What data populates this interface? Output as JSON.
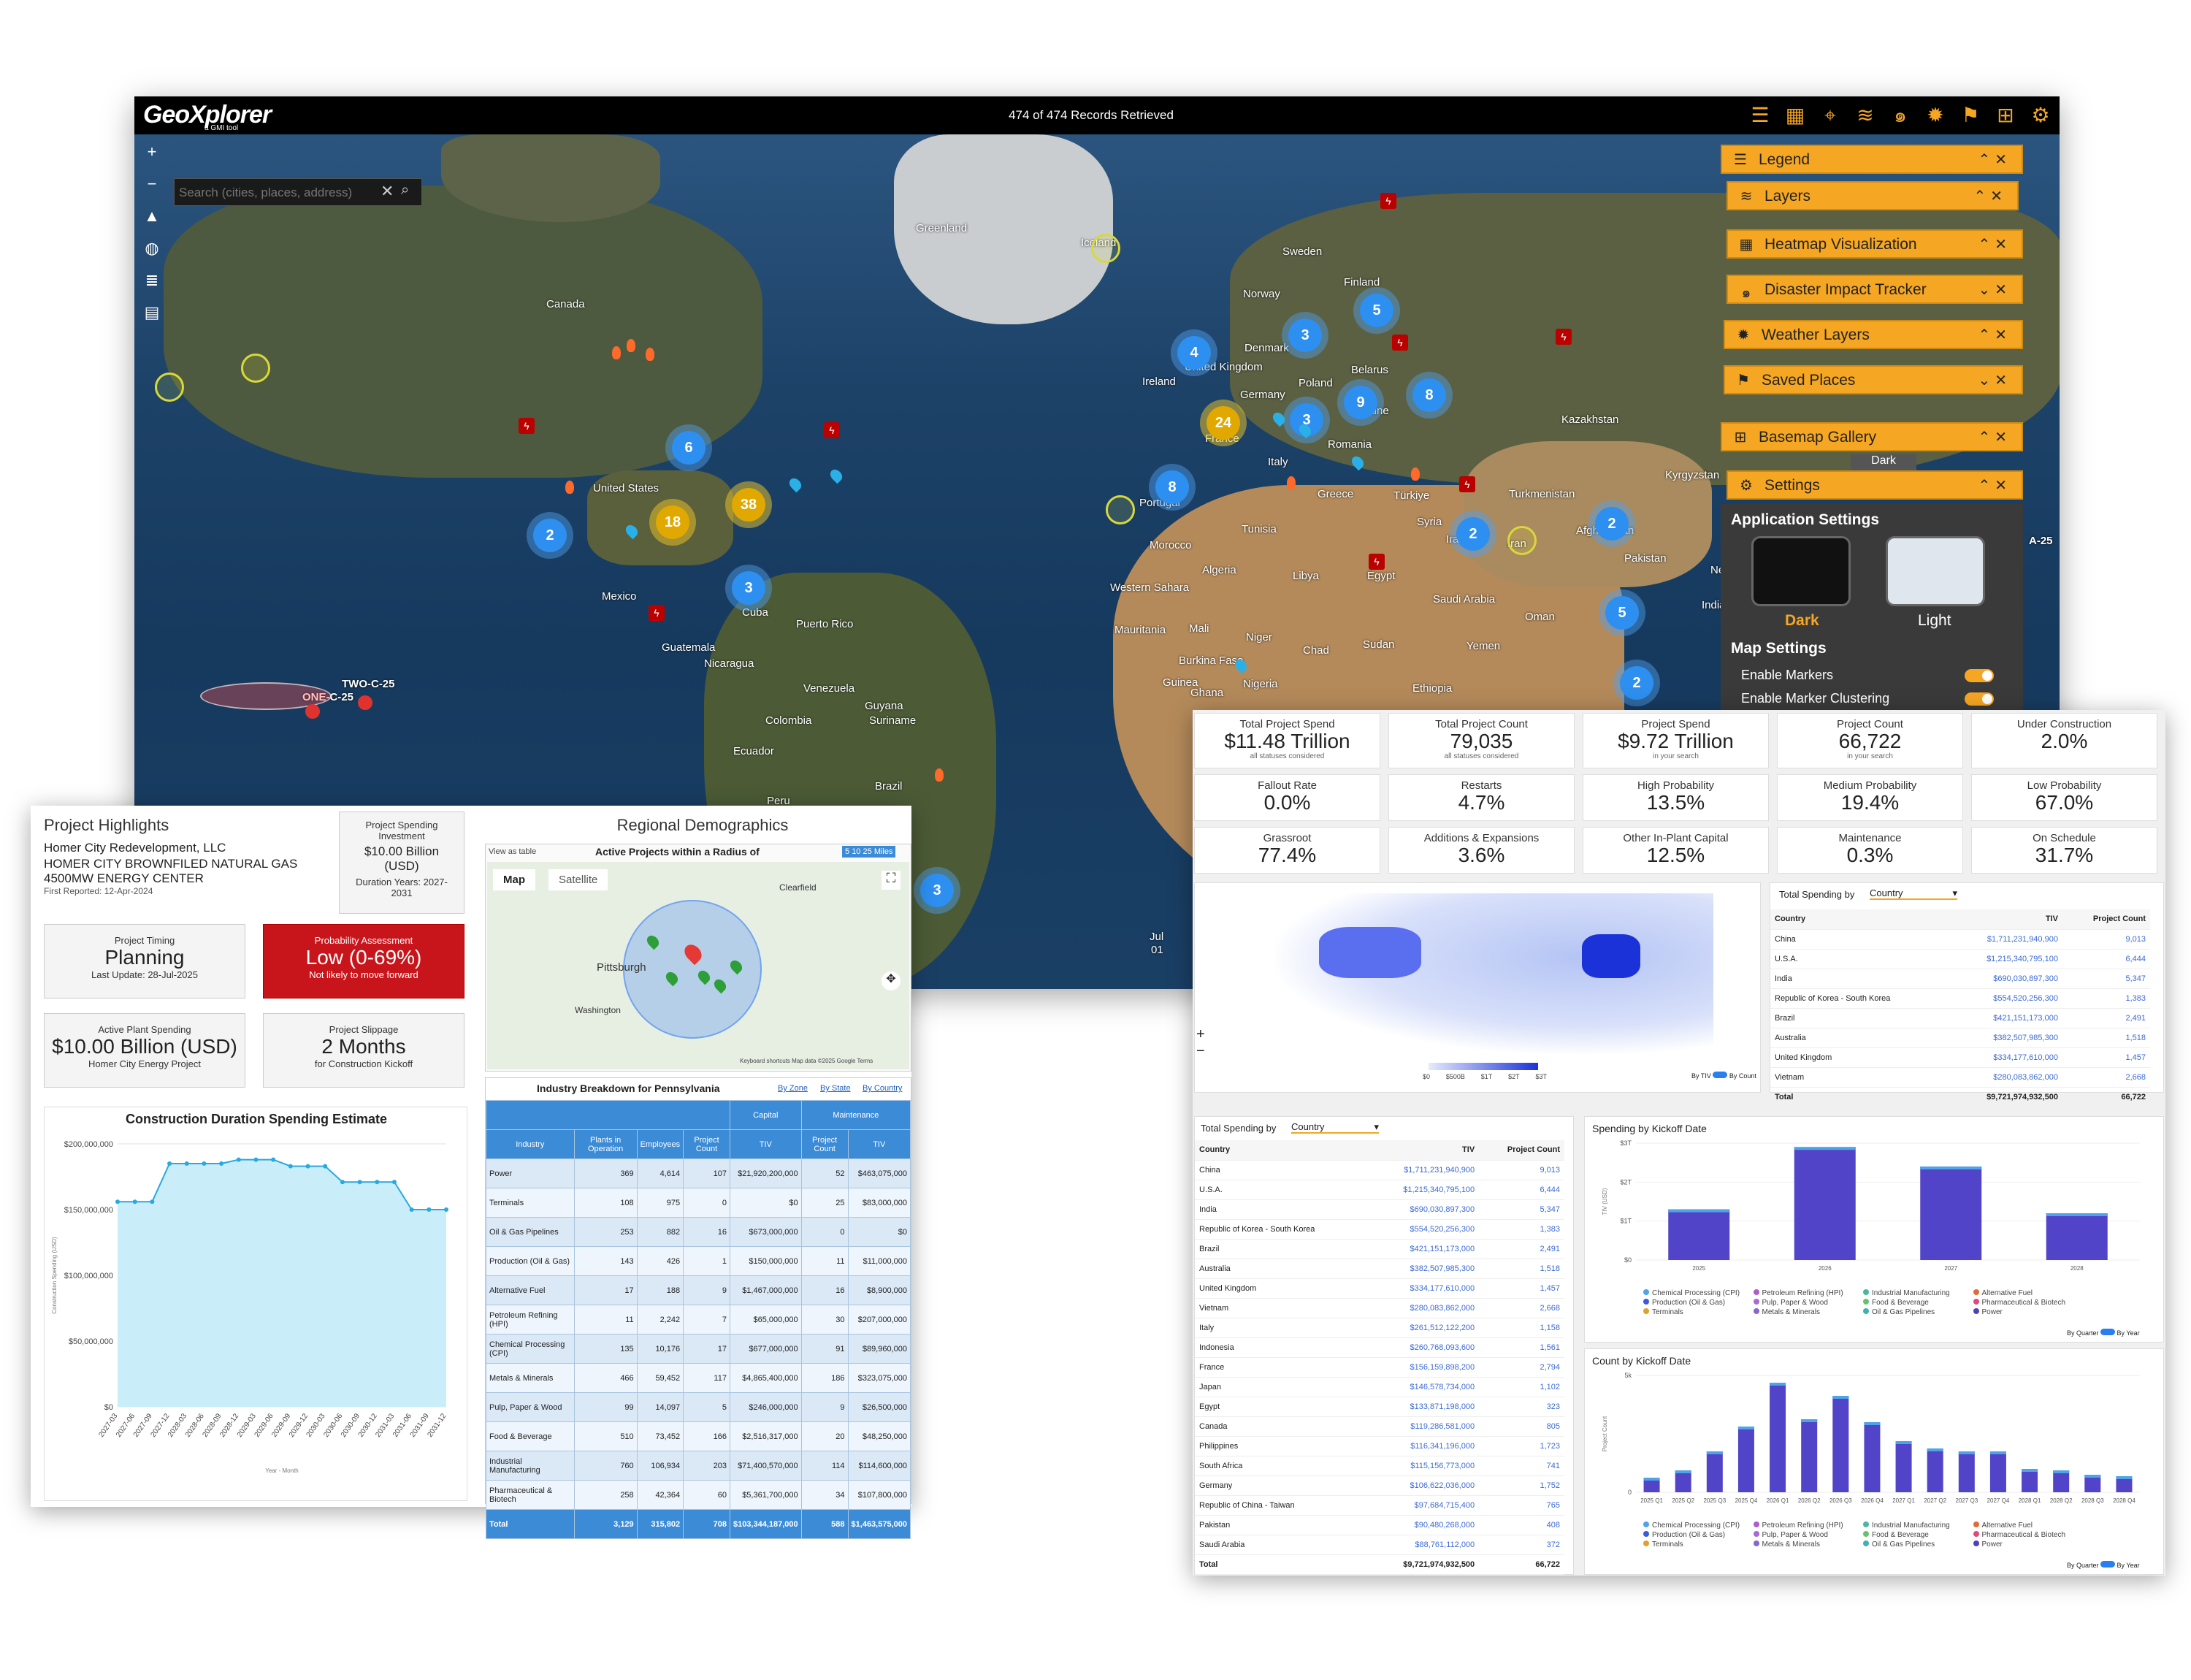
{
  "app": {
    "logo": "GeoXplorer",
    "logo_sub": "a GMI tool",
    "records": "474 of 474 Records Retrieved",
    "search_placeholder": "Search (cities, places, address)"
  },
  "panels": [
    {
      "label": "Legend",
      "icon": "list-icon"
    },
    {
      "label": "Layers",
      "icon": "layers-icon"
    },
    {
      "label": "Heatmap Visualization",
      "icon": "grid-icon"
    },
    {
      "label": "Disaster Impact Tracker",
      "icon": "hurricane-icon"
    },
    {
      "label": "Weather Layers",
      "icon": "gear-cloud-icon"
    },
    {
      "label": "Saved Places",
      "icon": "bookmark-icon"
    },
    {
      "label": "Basemap Gallery",
      "icon": "gallery-icon"
    },
    {
      "label": "Settings",
      "icon": "gear-icon"
    }
  ],
  "settings": {
    "app_heading": "Application Settings",
    "dark": "Dark",
    "light": "Light",
    "map_heading": "Map Settings",
    "enable_markers": "Enable Markers",
    "enable_clustering": "Enable Marker Clustering",
    "basemap_peek": "Dark"
  },
  "map_labels": {
    "greenland": "Greenland",
    "iceland": "Iceland",
    "sweden": "Sweden",
    "finland": "Finland",
    "norway": "Norway",
    "canada": "Canada",
    "denmark": "Denmark",
    "uk": "United Kingdom",
    "ireland": "Ireland",
    "belarus": "Belarus",
    "poland": "Poland",
    "germany": "Germany",
    "ukraine": "Ukraine",
    "kazakhstan": "Kazakhstan",
    "italy": "Italy",
    "romania": "Romania",
    "france": "France",
    "portugal": "Portugal",
    "greece": "Greece",
    "turkiye": "Türkiye",
    "kyrgyzstan": "Kyrgyzstan",
    "turkmenistan": "Turkmenistan",
    "us": "United States",
    "morocco": "Morocco",
    "tunisia": "Tunisia",
    "syria": "Syria",
    "iraq": "Iraq",
    "iran": "Iran",
    "afghanistan": "Afghanistan",
    "pakistan": "Pakistan",
    "nepal": "Nepal",
    "india": "India",
    "mexico": "Mexico",
    "cuba": "Cuba",
    "puerto_rico": "Puerto Rico",
    "algeria": "Algeria",
    "libya": "Libya",
    "egypt": "Egypt",
    "saudi": "Saudi Arabia",
    "oman": "Oman",
    "western_sahara": "Western Sahara",
    "mauritania": "Mauritania",
    "mali": "Mali",
    "niger": "Niger",
    "chad": "Chad",
    "sudan": "Sudan",
    "yemen": "Yemen",
    "guatemala": "Guatemala",
    "nicaragua": "Nicaragua",
    "venezuela": "Venezuela",
    "guyana": "Guyana",
    "suriname": "Suriname",
    "colombia": "Colombia",
    "ecuador": "Ecuador",
    "burkina": "Burkina Faso",
    "guinea": "Guinea",
    "ghana": "Ghana",
    "nigeria": "Nigeria",
    "ethiopia": "Ethiopia",
    "brazil": "Brazil",
    "peru": "Peru",
    "storm1": "TWO-C-25",
    "storm2": "ONE-C-25",
    "storm3": "A-25",
    "jul": "Jul",
    "jul01": "01"
  },
  "clusters": [
    "4",
    "3",
    "5",
    "6",
    "9",
    "8",
    "24",
    "2",
    "3",
    "2",
    "2",
    "5",
    "8",
    "3",
    "18",
    "38",
    "2",
    "3"
  ],
  "highlights": {
    "title": "Project Highlights",
    "company": "Homer City Redevelopment, LLC",
    "project": "HOMER CITY BROWNFILED NATURAL GAS",
    "project2": "4500MW ENERGY CENTER",
    "reported": "First Reported: 12-Apr-2024",
    "spend_title": "Project Spending Investment",
    "spend_value": "$10.00 Billion (USD)",
    "duration": "Duration Years: 2027-2031",
    "timing_title": "Project Timing",
    "timing_value": "Planning",
    "timing_sub": "Last Update: 28-Jul-2025",
    "prob_title": "Probability Assessment",
    "prob_value": "Low (0-69%)",
    "prob_sub": "Not likely to move forward",
    "plant_title": "Active Plant Spending",
    "plant_value": "$10.00 Billion (USD)",
    "plant_sub": "Homer City Energy Project",
    "slip_title": "Project Slippage",
    "slip_value": "2 Months",
    "slip_sub": "for Construction Kickoff",
    "chart_title": "Construction Duration Spending Estimate",
    "region_title": "Regional Demographics",
    "radius_title": "Active Projects within a Radius of",
    "view_table": "View as table",
    "radius_opts": [
      "5",
      "10",
      "25",
      "Miles"
    ],
    "map_tab": "Map",
    "sat_tab": "Satellite",
    "city": "Pittsburgh",
    "city2": "Washington",
    "city3": "Clearfield",
    "map_credit": "Keyboard shortcuts  Map data ©2025 Google  Terms",
    "industry_title": "Industry Breakdown for Pennsylvania",
    "by_zone": "By Zone",
    "by_state": "By State",
    "by_country": "By Country",
    "capital": "Capital",
    "maintenance": "Maintenance"
  },
  "chart_data": [
    {
      "type": "area",
      "title": "Construction Duration Spending Estimate",
      "xlabel": "Year - Month",
      "ylabel": "Construction Spending (USD)",
      "yticks": [
        "$200,000,000",
        "$150,000,000",
        "$100,000,000",
        "$50,000,000",
        "$0"
      ],
      "ylim": [
        0,
        200000000
      ],
      "x": [
        "2027-03",
        "2027-06",
        "2027-09",
        "2027-12",
        "2028-03",
        "2028-06",
        "2028-09",
        "2028-12",
        "2029-03",
        "2029-06",
        "2029-09",
        "2029-12",
        "2030-03",
        "2030-06",
        "2030-09",
        "2030-12",
        "2031-03",
        "2031-06",
        "2031-09",
        "2031-12"
      ],
      "y": [
        156000000,
        156000000,
        156000000,
        185000000,
        185000000,
        185000000,
        185000000,
        188000000,
        188000000,
        188000000,
        183000000,
        183000000,
        183000000,
        171000000,
        171000000,
        171000000,
        171000000,
        150000000,
        150000000,
        150000000
      ]
    },
    {
      "type": "bar",
      "title": "Spending by Kickoff Date",
      "categories": [
        "2025",
        "2026",
        "2027",
        "2028"
      ],
      "yticks": [
        "$3T",
        "$2T",
        "$1T",
        "$0"
      ],
      "ylim": [
        0,
        3
      ],
      "series": [
        {
          "name": "Chemical Processing (CPI)",
          "values": [
            1.3,
            2.9,
            2.4,
            1.2
          ]
        }
      ]
    },
    {
      "type": "bar",
      "title": "Count by Kickoff Date",
      "categories": [
        "2025 Q1",
        "2025 Q2",
        "2025 Q3",
        "2025 Q4",
        "2026 Q1",
        "2026 Q2",
        "2026 Q3",
        "2026 Q4",
        "2027 Q1",
        "2027 Q2",
        "2027 Q3",
        "2027 Q4",
        "2028 Q1",
        "2028 Q2",
        "2028 Q3",
        "2028 Q4"
      ],
      "yticks": [
        "5k",
        "0"
      ],
      "ylim": [
        0,
        8
      ],
      "series": [
        {
          "name": "Chemical Processing (CPI)",
          "values": [
            1.0,
            1.5,
            2.8,
            4.5,
            7.5,
            5.0,
            6.6,
            4.8,
            3.5,
            3.0,
            2.8,
            2.8,
            1.6,
            1.5,
            1.2,
            1.1
          ]
        }
      ]
    }
  ],
  "industry": {
    "headers": [
      "Industry",
      "Plants in Operation",
      "Employees",
      "Project Count",
      "TIV",
      "Project Count",
      "TIV"
    ],
    "rows": [
      [
        "Power",
        "369",
        "4,614",
        "107",
        "$21,920,200,000",
        "52",
        "$463,075,000"
      ],
      [
        "Terminals",
        "108",
        "975",
        "0",
        "$0",
        "25",
        "$83,000,000"
      ],
      [
        "Oil & Gas Pipelines",
        "253",
        "882",
        "16",
        "$673,000,000",
        "0",
        "$0"
      ],
      [
        "Production (Oil & Gas)",
        "143",
        "426",
        "1",
        "$150,000,000",
        "11",
        "$11,000,000"
      ],
      [
        "Alternative Fuel",
        "17",
        "188",
        "9",
        "$1,467,000,000",
        "16",
        "$8,900,000"
      ],
      [
        "Petroleum Refining (HPI)",
        "11",
        "2,242",
        "7",
        "$65,000,000",
        "30",
        "$207,000,000"
      ],
      [
        "Chemical Processing (CPI)",
        "135",
        "10,176",
        "17",
        "$677,000,000",
        "91",
        "$89,960,000"
      ],
      [
        "Metals & Minerals",
        "466",
        "59,452",
        "117",
        "$4,865,400,000",
        "186",
        "$323,075,000"
      ],
      [
        "Pulp, Paper & Wood",
        "99",
        "14,097",
        "5",
        "$246,000,000",
        "9",
        "$26,500,000"
      ],
      [
        "Food & Beverage",
        "510",
        "73,452",
        "166",
        "$2,516,317,000",
        "20",
        "$48,250,000"
      ],
      [
        "Industrial Manufacturing",
        "760",
        "106,934",
        "203",
        "$71,400,570,000",
        "114",
        "$114,600,000"
      ],
      [
        "Pharmaceutical & Biotech",
        "258",
        "42,364",
        "60",
        "$5,361,700,000",
        "34",
        "$107,800,000"
      ],
      [
        "Total",
        "3,129",
        "315,802",
        "708",
        "$103,344,187,000",
        "588",
        "$1,463,575,000"
      ]
    ]
  },
  "kpis": [
    {
      "t": "Total Project Spend",
      "v": "$11.48 Trillion",
      "s": "all statuses considered"
    },
    {
      "t": "Total Project Count",
      "v": "79,035",
      "s": "all statuses considered"
    },
    {
      "t": "Project Spend",
      "v": "$9.72 Trillion",
      "s": "in your search"
    },
    {
      "t": "Project Count",
      "v": "66,722",
      "s": "in your search"
    },
    {
      "t": "Under Construction",
      "v": "2.0%",
      "s": ""
    },
    {
      "t": "Fallout Rate",
      "v": "0.0%",
      "s": ""
    },
    {
      "t": "Restarts",
      "v": "4.7%",
      "s": ""
    },
    {
      "t": "High Probability",
      "v": "13.5%",
      "s": ""
    },
    {
      "t": "Medium Probability",
      "v": "19.4%",
      "s": ""
    },
    {
      "t": "Low Probability",
      "v": "67.0%",
      "s": ""
    },
    {
      "t": "Grassroot",
      "v": "77.4%",
      "s": ""
    },
    {
      "t": "Additions & Expansions",
      "v": "3.6%",
      "s": ""
    },
    {
      "t": "Other In-Plant Capital",
      "v": "12.5%",
      "s": ""
    },
    {
      "t": "Maintenance",
      "v": "0.3%",
      "s": ""
    },
    {
      "t": "On Schedule",
      "v": "31.7%",
      "s": ""
    }
  ],
  "spend_tables": {
    "label": "Total Spending by",
    "select": "Country",
    "col1": "Country",
    "col2": "TIV",
    "col3": "Project Count",
    "toggle_tiv": "By TIV",
    "toggle_count": "By Count",
    "map_scale": [
      "$0",
      "$500B",
      "$1T",
      "$2T",
      "$3T"
    ],
    "short_rows": [
      [
        "China",
        "$1,711,231,940,900",
        "9,013"
      ],
      [
        "U.S.A.",
        "$1,215,340,795,100",
        "6,444"
      ],
      [
        "India",
        "$690,030,897,300",
        "5,347"
      ],
      [
        "Republic of Korea - South Korea",
        "$554,520,256,300",
        "1,383"
      ],
      [
        "Brazil",
        "$421,151,173,000",
        "2,491"
      ],
      [
        "Australia",
        "$382,507,985,300",
        "1,518"
      ],
      [
        "United Kingdom",
        "$334,177,610,000",
        "1,457"
      ],
      [
        "Vietnam",
        "$280,083,862,000",
        "2,668"
      ]
    ],
    "long_rows": [
      [
        "China",
        "$1,711,231,940,900",
        "9,013"
      ],
      [
        "U.S.A.",
        "$1,215,340,795,100",
        "6,444"
      ],
      [
        "India",
        "$690,030,897,300",
        "5,347"
      ],
      [
        "Republic of Korea - South Korea",
        "$554,520,256,300",
        "1,383"
      ],
      [
        "Brazil",
        "$421,151,173,000",
        "2,491"
      ],
      [
        "Australia",
        "$382,507,985,300",
        "1,518"
      ],
      [
        "United Kingdom",
        "$334,177,610,000",
        "1,457"
      ],
      [
        "Vietnam",
        "$280,083,862,000",
        "2,668"
      ],
      [
        "Italy",
        "$261,512,122,200",
        "1,158"
      ],
      [
        "Indonesia",
        "$260,768,093,600",
        "1,561"
      ],
      [
        "France",
        "$156,159,898,200",
        "2,794"
      ],
      [
        "Japan",
        "$146,578,734,000",
        "1,102"
      ],
      [
        "Egypt",
        "$133,871,198,000",
        "323"
      ],
      [
        "Canada",
        "$119,286,581,000",
        "805"
      ],
      [
        "Philippines",
        "$116,341,196,000",
        "1,723"
      ],
      [
        "South Africa",
        "$115,156,773,000",
        "741"
      ],
      [
        "Germany",
        "$106,622,036,000",
        "1,752"
      ],
      [
        "Republic of China - Taiwan",
        "$97,684,715,400",
        "765"
      ],
      [
        "Pakistan",
        "$90,480,268,000",
        "408"
      ],
      [
        "Saudi Arabia",
        "$88,761,112,000",
        "372"
      ]
    ],
    "total": [
      "Total",
      "$9,721,974,932,500",
      "66,722"
    ]
  },
  "kickoff": {
    "legend": [
      "Chemical Processing (CPI)",
      "Petroleum Refining (HPI)",
      "Industrial Manufacturing",
      "Alternative Fuel",
      "Production (Oil & Gas)",
      "Pulp, Paper & Wood",
      "Food & Beverage",
      "Pharmaceutical & Biotech",
      "Terminals",
      "Metals & Minerals",
      "Oil & Gas Pipelines",
      "Power"
    ],
    "legend_colors": [
      "#4fa3e8",
      "#b05ccf",
      "#4ab8a0",
      "#e06a3a",
      "#3d5bd8",
      "#a86ad8",
      "#6ac070",
      "#e04a7a",
      "#e0a030",
      "#8866cc",
      "#40b0b0",
      "#5040c0"
    ],
    "toggle_q": "By Quarter",
    "toggle_y": "By Year",
    "ylabel_spend": "TIV (USD)",
    "ylabel_count": "Project Count"
  }
}
